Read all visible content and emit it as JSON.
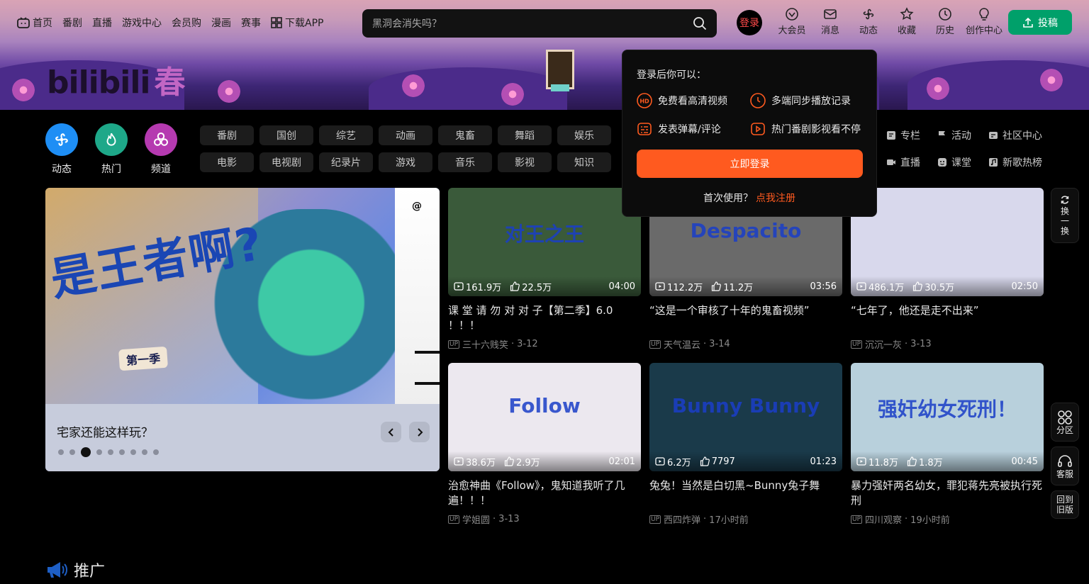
{
  "header": {
    "left_nav": [
      {
        "label": "首页",
        "icon": "tv-icon"
      },
      {
        "label": "番剧"
      },
      {
        "label": "直播"
      },
      {
        "label": "游戏中心"
      },
      {
        "label": "会员购"
      },
      {
        "label": "漫画"
      },
      {
        "label": "赛事"
      },
      {
        "label": "下载APP",
        "icon": "app-grid-icon"
      }
    ],
    "search_placeholder": "黑洞会消失吗？",
    "login_label": "登录",
    "right_nav": [
      {
        "label": "大会员",
        "icon": "vip-icon"
      },
      {
        "label": "消息",
        "icon": "mail-icon"
      },
      {
        "label": "动态",
        "icon": "fan-icon"
      },
      {
        "label": "收藏",
        "icon": "star-icon"
      },
      {
        "label": "历史",
        "icon": "clock-icon"
      },
      {
        "label": "创作中心",
        "icon": "bulb-icon"
      }
    ],
    "upload_label": "投稿"
  },
  "banner": {
    "logo_text": "bilibili",
    "logo_season": "春"
  },
  "quick_channels": [
    {
      "label": "动态",
      "color": "#1e8ef5"
    },
    {
      "label": "热门",
      "color": "#1ea889"
    },
    {
      "label": "频道",
      "color": "#b53ab0"
    }
  ],
  "categories": [
    "番剧",
    "国创",
    "综艺",
    "动画",
    "鬼畜",
    "舞蹈",
    "娱乐",
    "电影",
    "电视剧",
    "纪录片",
    "游戏",
    "音乐",
    "影视",
    "知识"
  ],
  "right_categories": [
    {
      "label": "专栏",
      "icon": "article-icon"
    },
    {
      "label": "活动",
      "icon": "flag-icon"
    },
    {
      "label": "社区中心",
      "icon": "community-icon"
    },
    {
      "label": "直播",
      "icon": "live-icon"
    },
    {
      "label": "课堂",
      "icon": "classroom-icon"
    },
    {
      "label": "新歌热榜",
      "icon": "music-icon"
    }
  ],
  "carousel": {
    "title": "宅家还能这样玩？",
    "art_text": "是王者啊?",
    "art_season": "第一季",
    "dot_count": 9,
    "active_dot": 3
  },
  "videos": [
    {
      "title": "课 堂 请 勿 对 对 子【第二季】6.0 ！！！",
      "views": "161.9万",
      "likes": "22.5万",
      "duration": "04:00",
      "author": "三十六贱笑",
      "date": "3-12",
      "thumb_text": "对王之王",
      "thumb_bg": "#3a5a3a"
    },
    {
      "title": "“这是一个审核了十年的鬼畜视频”",
      "views": "112.2万",
      "likes": "11.2万",
      "duration": "03:56",
      "author": "天气温云",
      "date": "3-14",
      "thumb_text": "Despacito",
      "thumb_bg": "#6a6a6a"
    },
    {
      "title": "“七年了，他还是走不出来”",
      "views": "486.1万",
      "likes": "30.5万",
      "duration": "02:50",
      "author": "沉沉一灰",
      "date": "3-13",
      "thumb_text": "",
      "thumb_bg": "#d8d8ec"
    },
    {
      "title": "治愈神曲《Follow》，鬼知道我听了几遍！！！",
      "views": "38.6万",
      "likes": "2.9万",
      "duration": "02:01",
      "author": "学姐圆",
      "date": "3-13",
      "thumb_text": "Follow",
      "thumb_bg": "#ece8ef"
    },
    {
      "title": "兔兔！当然是白切黑~Bunny兔子舞",
      "views": "6.2万",
      "likes": "7797",
      "duration": "01:23",
      "author": "西四炸弹",
      "date": "17小时前",
      "thumb_text": "Bunny Bunny",
      "thumb_bg": "#1a3a4a"
    },
    {
      "title": "暴力强奸两名幼女，罪犯蒋先亮被执行死刑",
      "views": "11.8万",
      "likes": "1.8万",
      "duration": "00:45",
      "author": "四川观察",
      "date": "19小时前",
      "thumb_text": "强奸幼女死刑！",
      "thumb_bg": "#b8d0dc"
    }
  ],
  "login_popup": {
    "title": "登录后你可以：",
    "benefits": [
      {
        "label": "免费看高清视频",
        "icon": "hd-icon"
      },
      {
        "label": "多端同步播放记录",
        "icon": "clock-icon"
      },
      {
        "label": "发表弹幕/评论",
        "icon": "danmaku-icon"
      },
      {
        "label": "热门番剧影视看不停",
        "icon": "play-icon"
      }
    ],
    "login_button": "立即登录",
    "register_prefix": "首次使用？",
    "register_link": "点我注册"
  },
  "float_bar": {
    "refresh": "换一换",
    "zone": "分区",
    "service": "客服",
    "old_version": "回到旧版"
  },
  "section": {
    "promo_title": "推广"
  },
  "colors": {
    "accent": "#ff5a1f",
    "upload": "#00a06a",
    "bili_blue": "#1e8ef5"
  }
}
